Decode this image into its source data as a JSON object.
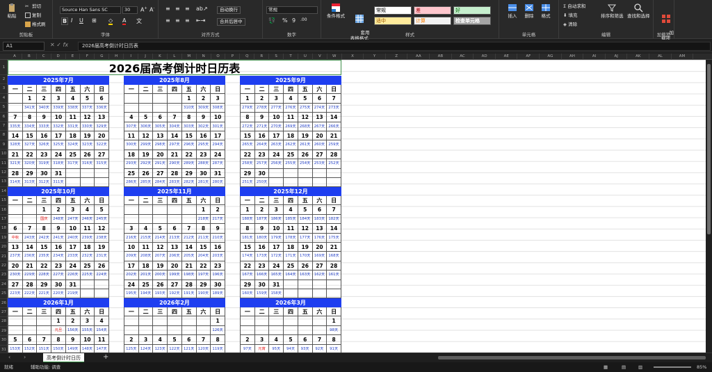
{
  "ribbon": {
    "clipboard": {
      "paste": "粘贴",
      "cut": "剪切",
      "copy": "复制",
      "format_painter": "格式刷",
      "label": "剪贴板"
    },
    "font": {
      "name": "Source Han Sans SC",
      "size": "30",
      "label": "字体",
      "bold": "B",
      "italic": "I",
      "underline": "U"
    },
    "alignment": {
      "wrap": "自动换行",
      "merge": "合并后居中",
      "label": "对齐方式"
    },
    "number": {
      "format": "常规",
      "label": "数字"
    },
    "styles": {
      "conditional": "条件格式",
      "table": "套用\n表格格式",
      "normal": "常规",
      "bad": "差",
      "good": "好",
      "neutral": "适中",
      "calc": "计算",
      "check": "检查单元格",
      "label": "样式"
    },
    "cells": {
      "insert": "插入",
      "delete": "删除",
      "format": "格式",
      "label": "单元格"
    },
    "editing": {
      "autosum": "自动求和",
      "fill": "填充",
      "clear": "清除",
      "sort": "排序和筛选",
      "find": "查找和选择",
      "label": "编辑"
    },
    "addins": {
      "addin": "加\n载项",
      "label": "加载项"
    }
  },
  "formula_bar": {
    "name_box": "A1",
    "content": "2026届高考倒计时日历表"
  },
  "sheet": {
    "title": "2026届高考倒计时日历表",
    "weekdays": [
      "一",
      "二",
      "三",
      "四",
      "五",
      "六",
      "日"
    ],
    "months": [
      {
        "name": "2025年7月",
        "offset": 1,
        "days": 31,
        "start": 341
      },
      {
        "name": "2025年8月",
        "offset": 4,
        "days": 31,
        "start": 310
      },
      {
        "name": "2025年9月",
        "offset": 0,
        "days": 30,
        "start": 279
      },
      {
        "name": "2025年10月",
        "offset": 2,
        "days": 31,
        "start": 249,
        "holidays": {
          "1": "国庆"
        }
      },
      {
        "name": "2025年11月",
        "offset": 5,
        "days": 30,
        "start": 218
      },
      {
        "name": "2025年12月",
        "offset": 0,
        "days": 31,
        "start": 188
      },
      {
        "name": "2026年1月",
        "offset": 3,
        "days": 31,
        "start": 157,
        "holidays": {
          "1": "元旦"
        }
      },
      {
        "name": "2026年2月",
        "offset": 6,
        "days": 28,
        "start": 126
      },
      {
        "name": "2026年3月",
        "offset": 6,
        "days": 31,
        "start": 98,
        "holidays": {
          "3": "元宵"
        }
      }
    ],
    "holiday_oct6": "中秋",
    "day_suffix": "天"
  },
  "columns": [
    "A",
    "B",
    "C",
    "D",
    "E",
    "F",
    "G",
    "H",
    "I",
    "J",
    "K",
    "L",
    "M",
    "N",
    "O",
    "P",
    "Q",
    "R",
    "S",
    "T",
    "U",
    "V",
    "W",
    "X",
    "Y",
    "Z",
    "AA",
    "AB",
    "AC",
    "AD",
    "AE",
    "AF",
    "AG",
    "AH",
    "AI",
    "AJ",
    "AK",
    "AL",
    "AM"
  ],
  "tabs": {
    "sheet_name": "高考倒计时日历"
  },
  "status": {
    "ready": "就绪",
    "accessibility": "辅助功能: 调查",
    "zoom": "85%"
  }
}
